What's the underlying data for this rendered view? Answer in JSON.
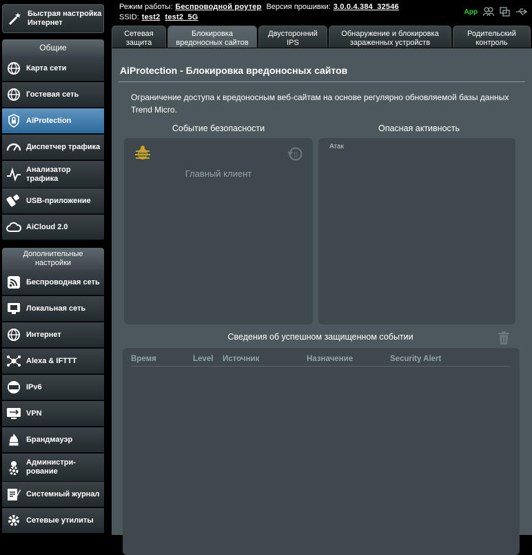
{
  "sidebar": {
    "quick_setup": {
      "label_line1": "Быстрая настройка",
      "label_line2": "Интернет",
      "icon": "wand-icon"
    },
    "group_general": "Общие",
    "general_items": [
      {
        "label": "Карта сети",
        "icon": "globe-icon"
      },
      {
        "label": "Гостевая сеть",
        "icon": "globe-icon"
      },
      {
        "label": "AiProtection",
        "icon": "lock-icon",
        "active": true
      },
      {
        "label": "Диспетчер трафика",
        "icon": "speedometer-icon"
      },
      {
        "label_line1": "Анализатор",
        "label_line2": "трафика",
        "icon": "pulse-icon"
      },
      {
        "label": "USB-приложение",
        "icon": "puzzle-icon"
      },
      {
        "label": "AiCloud 2.0",
        "icon": "cloud-icon"
      }
    ],
    "group_advanced_line1": "Дополнительные",
    "group_advanced_line2": "настройки",
    "advanced_items": [
      {
        "label": "Беспроводная сеть",
        "icon": "wifi-icon"
      },
      {
        "label": "Локальная сеть",
        "icon": "lan-icon"
      },
      {
        "label": "Интернет",
        "icon": "globe-icon"
      },
      {
        "label": "Alexa & IFTTT",
        "icon": "network-icon"
      },
      {
        "label": "IPv6",
        "icon": "ipv6-icon"
      },
      {
        "label": "VPN",
        "icon": "vpn-icon"
      },
      {
        "label": "Брандмауэр",
        "icon": "firewall-icon"
      },
      {
        "label_line1": "Администри-",
        "label_line2": "рование",
        "icon": "admin-gear-icon"
      },
      {
        "label": "Системный журнал",
        "icon": "log-icon"
      },
      {
        "label": "Сетевые утилиты",
        "icon": "tools-icon"
      }
    ]
  },
  "topbar": {
    "mode_label": "Режим работы:",
    "mode_value": "Беспроводной роутер",
    "firmware_label": "Версия прошивки:",
    "firmware_value": "3.0.0.4.384_32546",
    "ssid_label": "SSID:",
    "ssid_1": "test2",
    "ssid_2": "test2_5G",
    "app_label": "App",
    "icons": [
      "users-icon",
      "copy-icon",
      "usb-icon"
    ]
  },
  "tabs": [
    {
      "line1": "Сетевая",
      "line2": "защита"
    },
    {
      "line1": "Блокировка",
      "line2": "вредоносных сайтов",
      "active": true
    },
    {
      "line1": "Двусторонний",
      "line2": "IPS"
    },
    {
      "line1": "Обнаружение и блокировка",
      "line2": "зараженных устройств"
    },
    {
      "line1": "Родительский",
      "line2": "контроль"
    }
  ],
  "main": {
    "title": "AiProtection - Блокировка вредоносных сайтов",
    "description": "Ограничение доступа к вредоносным веб-сайтам на основе регулярно обновляемой базы данных Trend Micro.",
    "security_event_title": "Событие безопасности",
    "main_client": "Главный клиент",
    "dangerous_activity_title": "Опасная активность",
    "attacks_label": "Атак",
    "protected_events_title": "Сведения об успешном защищенном событии",
    "table_headers": [
      "Время",
      "Level",
      "Источник",
      "Назначение",
      "Security Alert"
    ],
    "colors": {
      "panel": "#4d585d",
      "box": "#3f484d",
      "active_nav": "#4a82b0",
      "bug": "#c9a227"
    }
  }
}
